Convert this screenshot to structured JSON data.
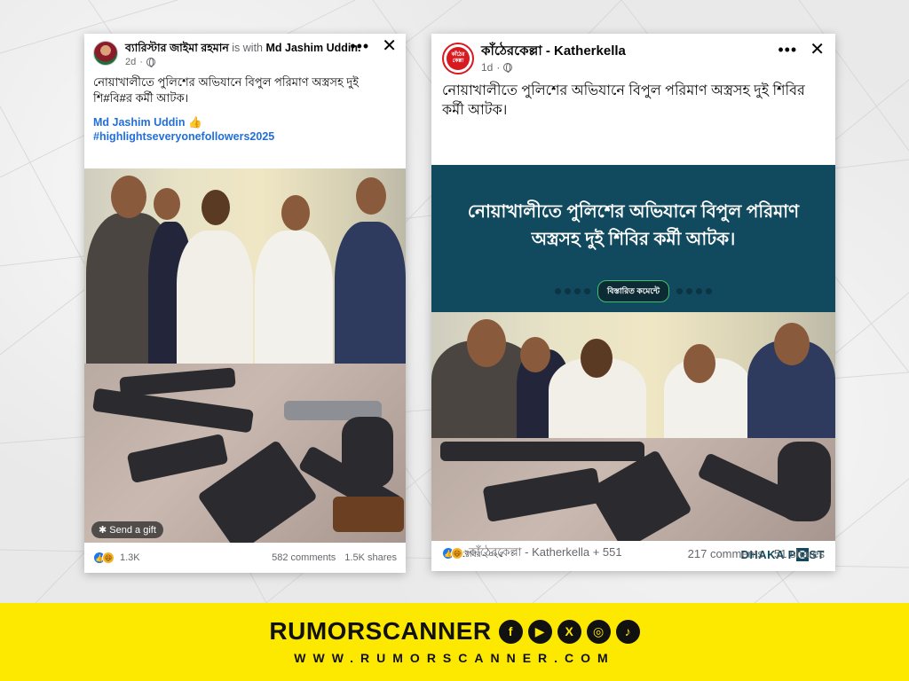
{
  "left_post": {
    "author": "ব্যারিস্টার জাইমা রহমান",
    "with_text": "is with",
    "tagged": "Md Jashim Uddin",
    "time": "2d",
    "text": "নোয়াখালীতে পুলিশের অভিযানে বিপুল পরিমাণ অস্ত্রসহ দুই শি#বি#র কর্মী আটক।",
    "tag_line_1": "Md Jashim Uddin 👍",
    "tag_line_2": "#highlightseveryonefollowers2025",
    "gift_label": "Send a gift",
    "reactions": "1.3K",
    "comments": "582 comments",
    "shares": "1.5K shares"
  },
  "right_post": {
    "page_name": "কাঁঠেরকেল্লা - Katherkella",
    "avatar_text": "কাঁঠের কেল্লা",
    "time": "1d",
    "text": "নোয়াখালীতে পুলিশের অভিযানে বিপুল পরিমাণ অস্ত্রসহ দুই শিবির কর্মী আটক।",
    "banner_headline": "নোয়াখালীতে পুলিশের অভিযানে বিপুল পরিমাণ অস্ত্রসহ দুই শিবির কর্মী আটক।",
    "banner_pill": "বিস্তারিত কমেন্টে",
    "date": "২৪ অক্টোবর ২০২৫",
    "source_logo_pre": "DHAKA P",
    "source_logo_o": "O",
    "source_logo_post": "ST",
    "reactions": "কাঁঠেরকেল্লা - Katherkella + 551",
    "comments": "217 comments",
    "shares": "51 shares"
  },
  "icons": {
    "more": "more-icon",
    "close": "close-icon",
    "globe": "globe-icon",
    "like": "like-icon",
    "haha": "haha-icon",
    "gift": "gift-icon"
  },
  "brand": {
    "name": "RUMORSCANNER",
    "website": "WWW.RUMORSCANNER.COM",
    "socials": [
      "facebook-icon",
      "youtube-icon",
      "x-icon",
      "instagram-icon",
      "tiktok-icon"
    ],
    "accent": "#fde800"
  }
}
